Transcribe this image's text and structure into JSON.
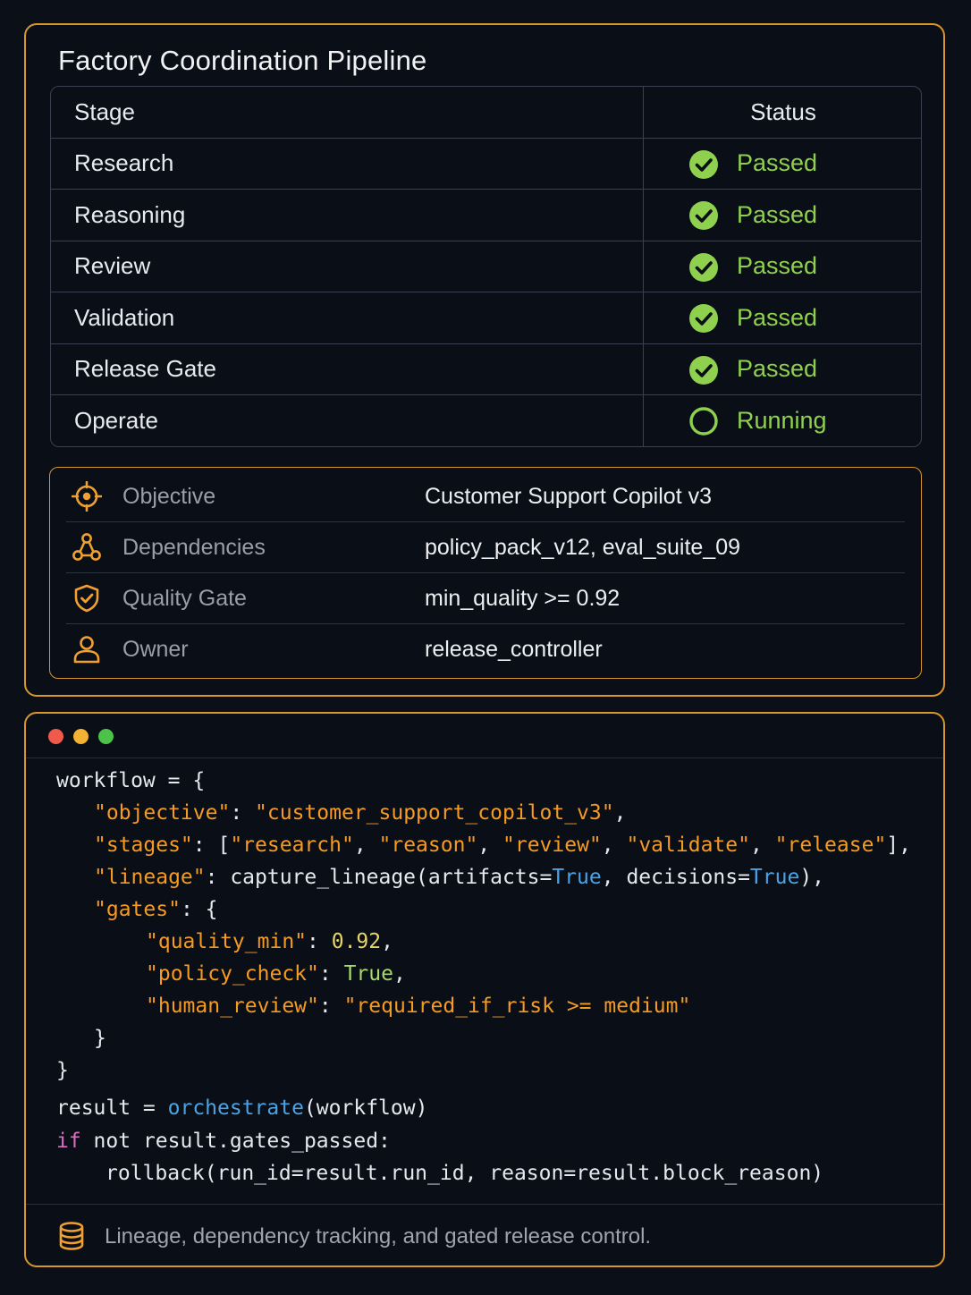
{
  "pipeline": {
    "title": "Factory Coordination Pipeline",
    "header": {
      "stage": "Stage",
      "status": "Status"
    },
    "rows": [
      {
        "stage": "Research",
        "status": "Passed"
      },
      {
        "stage": "Reasoning",
        "status": "Passed"
      },
      {
        "stage": "Review",
        "status": "Passed"
      },
      {
        "stage": "Validation",
        "status": "Passed"
      },
      {
        "stage": "Release Gate",
        "status": "Passed"
      },
      {
        "stage": "Operate",
        "status": "Running"
      }
    ],
    "status_colors": {
      "passed": "#8fd14f",
      "running": "#8fd14f"
    }
  },
  "meta": {
    "accent": "#d9962a",
    "rows": [
      {
        "icon": "target-icon",
        "label": "Objective",
        "value": "Customer Support Copilot v3"
      },
      {
        "icon": "dependencies-icon",
        "label": "Dependencies",
        "value": "policy_pack_v12, eval_suite_09"
      },
      {
        "icon": "shield-check-icon",
        "label": "Quality Gate",
        "value": "min_quality >= 0.92"
      },
      {
        "icon": "user-icon",
        "label": "Owner",
        "value": "release_controller"
      }
    ]
  },
  "code_window": {
    "traffic_lights": [
      "#ef5a4c",
      "#f2b233",
      "#4cc24a"
    ],
    "lines": {
      "l1": "workflow = {",
      "l2_key": "\"objective\"",
      "l2_sep": ": ",
      "l2_val": "\"customer_support_copilot_v3\"",
      "l2_end": ",",
      "l3_key": "\"stages\"",
      "l3_sep": ": [",
      "l3_v1": "\"research\"",
      "l3_v2": "\"reason\"",
      "l3_v3": "\"review\"",
      "l3_v4": "\"validate\"",
      "l3_v5": "\"release\"",
      "l3_end": "],",
      "l4_key": "\"lineage\"",
      "l4_a": ": capture_lineage(artifacts=",
      "l4_t1": "True",
      "l4_b": ", decisions=",
      "l4_t2": "True",
      "l4_end": "),",
      "l5_key": "\"gates\"",
      "l5_end": ": {",
      "l6_key": "\"quality_min\"",
      "l6_sep": ": ",
      "l6_val": "0.92",
      "l6_end": ",",
      "l7_key": "\"policy_check\"",
      "l7_sep": ": ",
      "l7_val": "True",
      "l7_end": ",",
      "l8_key": "\"human_review\"",
      "l8_sep": ": ",
      "l8_val": "\"required_if_risk >= medium\"",
      "l9": "}",
      "l10": "}",
      "l11_a": "result = ",
      "l11_fn": "orchestrate",
      "l11_b": "(workflow)",
      "l12_kw": "if",
      "l12_rest": " not result.gates_passed:",
      "l13": "rollback(run_id=result.run_id, reason=result.block_reason)"
    },
    "footer": {
      "icon": "database-icon",
      "text": "Lineage, dependency tracking, and gated release control."
    }
  }
}
